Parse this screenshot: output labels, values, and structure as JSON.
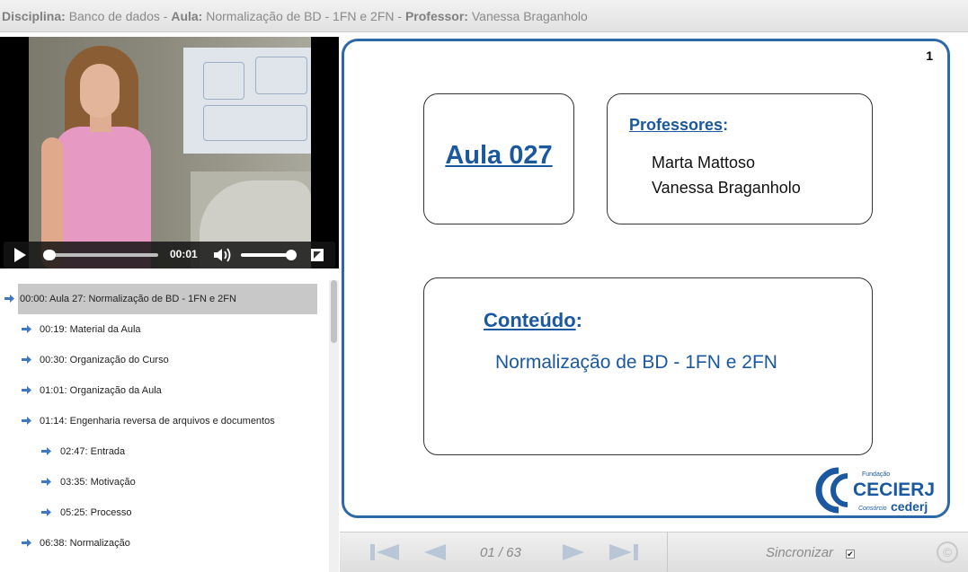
{
  "header": {
    "disciplina_label": "Disciplina:",
    "disciplina_value": "Banco de dados -",
    "aula_label": "Aula:",
    "aula_value": "Normalização de BD - 1FN e 2FN -",
    "professor_label": "Professor:",
    "professor_value": "Vanessa Braganholo"
  },
  "video": {
    "current_time": "00:01"
  },
  "chapters": [
    {
      "label": "00:00: Aula 27: Normalização de BD - 1FN e 2FN",
      "level": 0,
      "active": true
    },
    {
      "label": "00:19: Material da Aula",
      "level": 1
    },
    {
      "label": "00:30: Organização do Curso",
      "level": 1
    },
    {
      "label": "01:01: Organização da Aula",
      "level": 1
    },
    {
      "label": "01:14: Engenharia reversa de arquivos e documentos",
      "level": 1
    },
    {
      "label": "02:47: Entrada",
      "level": 2
    },
    {
      "label": "03:35: Motivação",
      "level": 2
    },
    {
      "label": "05:25: Processo",
      "level": 2
    },
    {
      "label": "06:38: Normalização",
      "level": 1
    }
  ],
  "slide": {
    "number": "1",
    "aula_title": "Aula 027",
    "professores_title": "Professores",
    "professores_colon": ":",
    "professores": [
      "Marta Mattoso",
      "Vanessa Braganholo"
    ],
    "conteudo_title": "Conteúdo",
    "conteudo_colon": ":",
    "conteudo_text": "Normalização de BD - 1FN e 2FN",
    "logo_small_top": "Fundação",
    "logo_main": "CECIERJ",
    "logo_small_bottom": "Consórcio",
    "logo_cederj": "cederj"
  },
  "nav": {
    "page": "01 / 63",
    "sync_label": "Sincronizar",
    "sync_checked": "✔"
  },
  "colors": {
    "accent_blue": "#1a58a0",
    "slide_border": "#2d69a8",
    "nav_arrow": "#b9c6d6"
  }
}
